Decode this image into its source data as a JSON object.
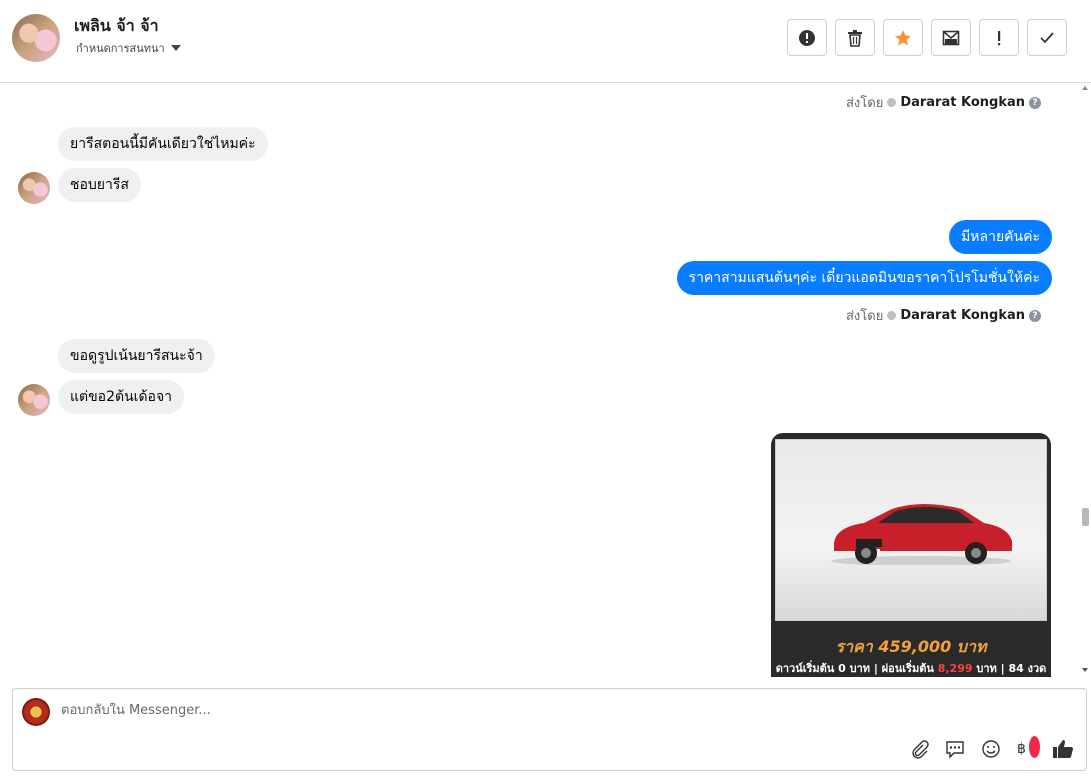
{
  "header": {
    "contact_name": "เพลิน จ้า จ้า",
    "subtitle": "กำหนดการสนทนา",
    "toolbar": [
      {
        "name": "spam-button",
        "icon": "alert-circle-icon"
      },
      {
        "name": "delete-button",
        "icon": "trash-icon"
      },
      {
        "name": "star-button",
        "icon": "star-icon"
      },
      {
        "name": "mark-unread-button",
        "icon": "envelope-icon"
      },
      {
        "name": "follow-up-button",
        "icon": "exclamation-icon"
      },
      {
        "name": "mark-done-button",
        "icon": "check-icon"
      }
    ]
  },
  "colors": {
    "outgoing_bubble": "#0a7cff",
    "incoming_bubble": "#f0f0f0",
    "star": "#f7923a",
    "price": "#f2a23a"
  },
  "messages": {
    "sent_by_label": "ส่งโดย",
    "sender_name": "Dararat Kongkan",
    "incoming_1": "ยารีสตอนนี้มีคันเดียวใช่ไหมค่ะ",
    "incoming_2": "ชอบยารีส",
    "outgoing_1": "มีหลายคันค่ะ",
    "outgoing_2": "ราคาสามแสนต้นๆค่ะ เดี๋ยวแอดมินขอราคาโปรโมชั่นให้ค่ะ",
    "incoming_3": "ขอดูรูปเน้นยารีสนะจ้า",
    "incoming_4": "แต่ขอ2ต้นเด้อจา"
  },
  "car_image": {
    "price": "ราคา 459,000 บาท",
    "terms_prefix": "ดาวน์เริ่มต้น 0 บาท | ผ่อนเริ่มต้น",
    "terms_amount": "8,299",
    "terms_suffix": "บาท | 84 งวด"
  },
  "composer": {
    "placeholder": "ตอบกลับใน Messenger..."
  }
}
